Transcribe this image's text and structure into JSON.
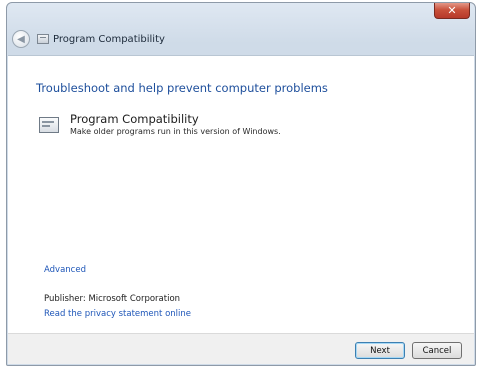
{
  "window": {
    "title": "Program Compatibility",
    "close_glyph": "✕"
  },
  "nav": {
    "back_glyph": "◀"
  },
  "main": {
    "heading": "Troubleshoot and help prevent computer problems",
    "troubleshooter": {
      "icon": "program-window-icon",
      "title": "Program Compatibility",
      "description": "Make older programs run in this version of Windows."
    },
    "advanced_link": "Advanced",
    "publisher": "Publisher: Microsoft Corporation",
    "privacy_link": "Read the privacy statement online"
  },
  "footer": {
    "next_label": "Next",
    "cancel_label": "Cancel"
  },
  "colors": {
    "link": "#1e56b8",
    "heading": "#1e4f9c",
    "close_button": "#c8503a"
  }
}
